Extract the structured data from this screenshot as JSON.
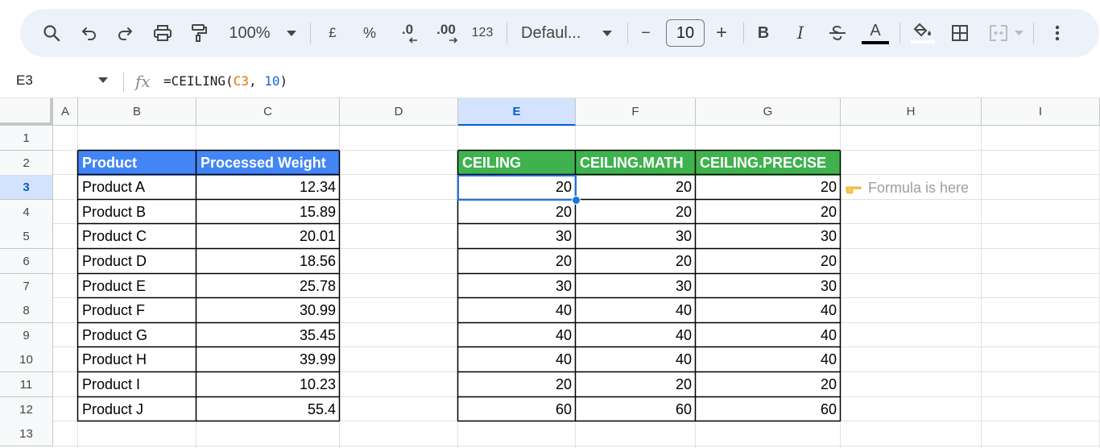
{
  "toolbar": {
    "zoom": "100%",
    "currency": "£",
    "percent": "%",
    "decrease_decimal": ".0",
    "increase_decimal": ".00",
    "number_format": "123",
    "font": "Defaul...",
    "font_size": "10",
    "minus": "−",
    "plus": "+",
    "bold": "B",
    "italic": "I",
    "text_color": "A"
  },
  "formula_bar": {
    "cell_ref": "E3",
    "fx": "fx",
    "formula_prefix": "=CEILING(",
    "formula_ref": "C3",
    "formula_sep": ", ",
    "formula_num": "10",
    "formula_suffix": ")"
  },
  "columns": [
    "A",
    "B",
    "C",
    "D",
    "E",
    "F",
    "G",
    "H",
    "I"
  ],
  "rows": [
    "1",
    "2",
    "3",
    "4",
    "5",
    "6",
    "7",
    "8",
    "9",
    "10",
    "11",
    "12",
    "13"
  ],
  "selected_cell": {
    "column": "E",
    "row": "3"
  },
  "table_left": {
    "headers": [
      "Product",
      "Processed Weight"
    ],
    "rows": [
      [
        "Product A",
        "12.34"
      ],
      [
        "Product B",
        "15.89"
      ],
      [
        "Product C",
        "20.01"
      ],
      [
        "Product D",
        "18.56"
      ],
      [
        "Product E",
        "25.78"
      ],
      [
        "Product F",
        "30.99"
      ],
      [
        "Product G",
        "35.45"
      ],
      [
        "Product H",
        "39.99"
      ],
      [
        "Product I",
        "10.23"
      ],
      [
        "Product J",
        "55.4"
      ]
    ]
  },
  "table_right": {
    "headers": [
      "CEILING",
      "CEILING.MATH",
      "CEILING.PRECISE"
    ],
    "rows": [
      [
        "20",
        "20",
        "20"
      ],
      [
        "20",
        "20",
        "20"
      ],
      [
        "30",
        "30",
        "30"
      ],
      [
        "20",
        "20",
        "20"
      ],
      [
        "30",
        "30",
        "30"
      ],
      [
        "40",
        "40",
        "40"
      ],
      [
        "40",
        "40",
        "40"
      ],
      [
        "40",
        "40",
        "40"
      ],
      [
        "20",
        "20",
        "20"
      ],
      [
        "60",
        "60",
        "60"
      ]
    ]
  },
  "note": {
    "icon": "pointing-hand-icon",
    "text": "Formula is here"
  },
  "colors": {
    "header_blue": "#4285f4",
    "header_green": "#3fb24e",
    "selection": "#1a73e8",
    "toolbar_bg": "#edf2fa"
  }
}
